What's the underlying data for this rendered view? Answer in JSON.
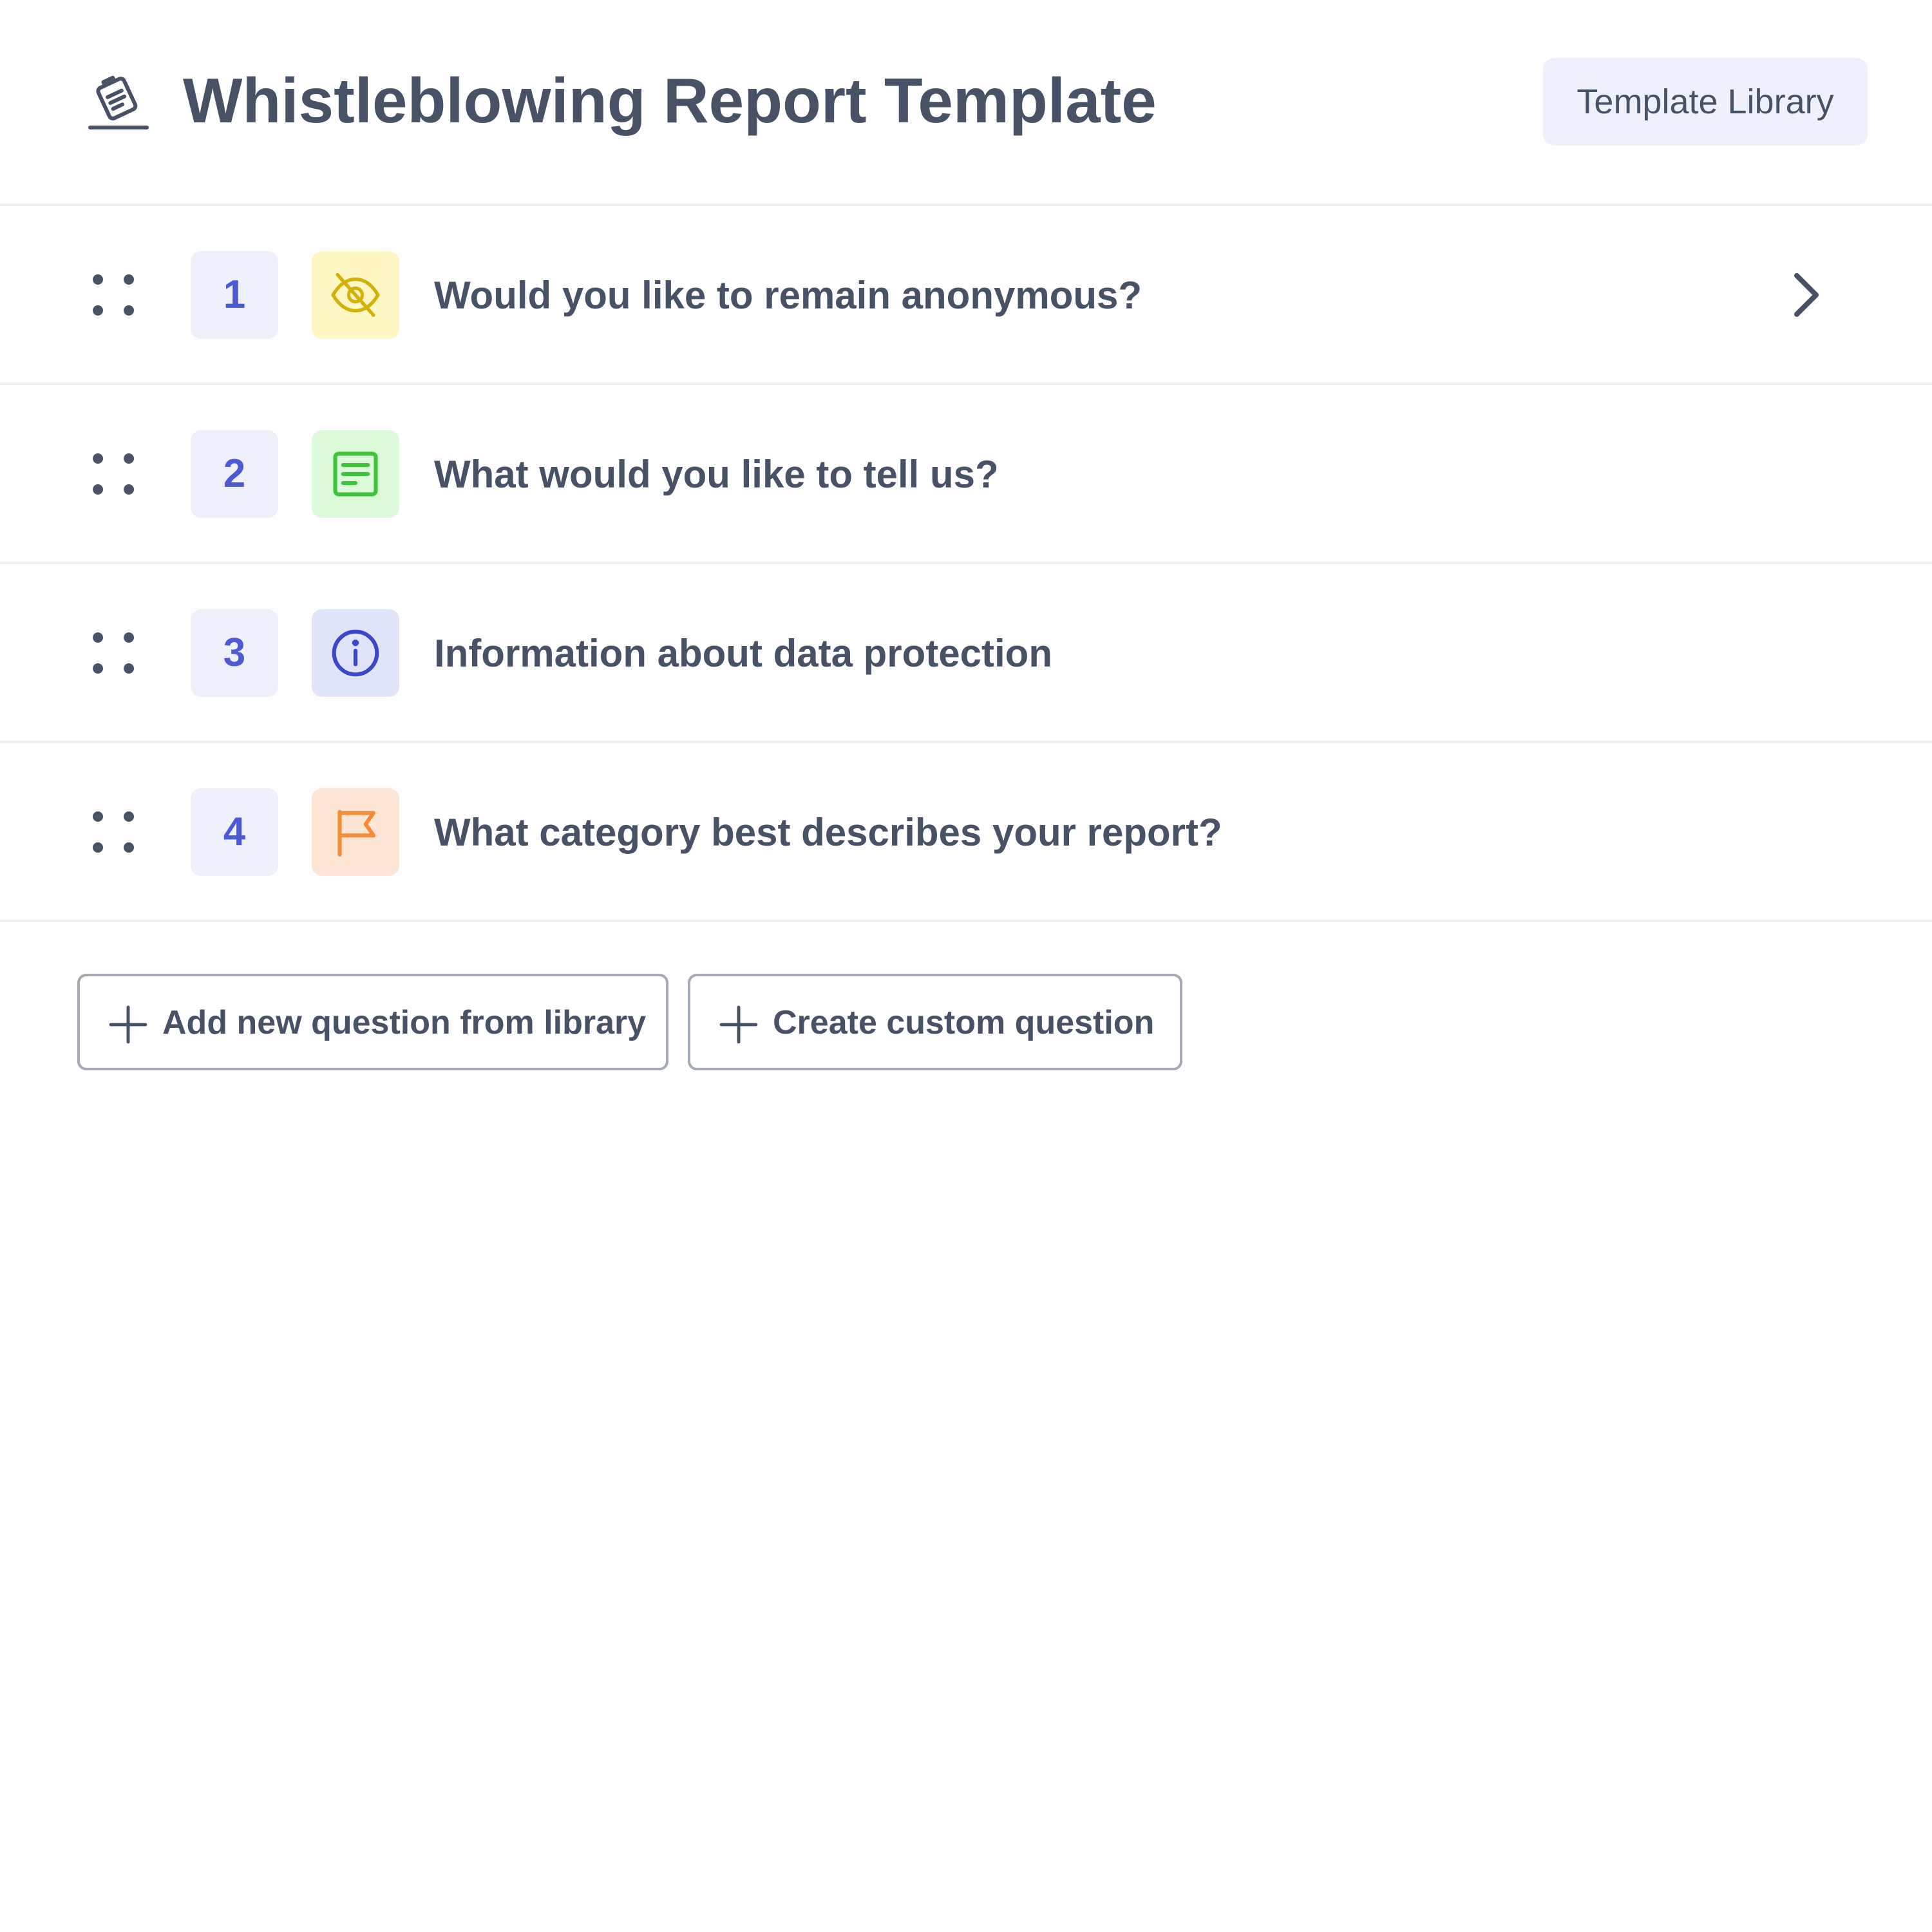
{
  "header": {
    "icon": "clipboard-pen-icon",
    "title": "Whistleblowing Report Template",
    "library_button": "Template Library"
  },
  "questions": [
    {
      "number": "1",
      "label": "Would you like to remain anonymous?",
      "type_icon": "eye-off-icon",
      "icon_bg": "#fef7c3",
      "icon_color": "#d4b106",
      "has_chevron": true
    },
    {
      "number": "2",
      "label": "What would you like to tell us?",
      "type_icon": "text-lines-icon",
      "icon_bg": "#dcfad9",
      "icon_color": "#3ec43a",
      "has_chevron": false
    },
    {
      "number": "3",
      "label": "Information about data protection",
      "type_icon": "info-icon",
      "icon_bg": "#e0e4f9",
      "icon_color": "#3b48c9",
      "has_chevron": false
    },
    {
      "number": "4",
      "label": "What category best describes your report?",
      "type_icon": "flag-icon",
      "icon_bg": "#fde6d6",
      "icon_color": "#f58d38",
      "has_chevron": false
    }
  ],
  "actions": {
    "add_from_library": "Add new question from library",
    "create_custom": "Create custom question"
  },
  "colors": {
    "text": "#475266",
    "number_accent": "#4c5bd4",
    "number_bg": "#eef0fc",
    "divider": "#eceef1"
  }
}
